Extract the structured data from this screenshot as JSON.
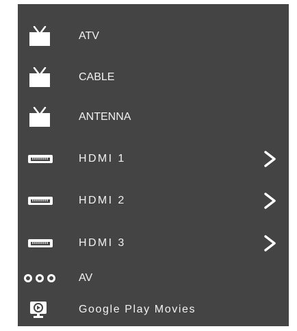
{
  "inputs": {
    "items": [
      {
        "label": "ATV",
        "icon": "tv-icon",
        "has_submenu": false
      },
      {
        "label": "CABLE",
        "icon": "tv-icon",
        "has_submenu": false
      },
      {
        "label": "ANTENNA",
        "icon": "tv-icon",
        "has_submenu": false
      },
      {
        "label": "HDMI 1",
        "icon": "hdmi-port-icon",
        "has_submenu": true,
        "submenu_icon": "chevron-right-icon"
      },
      {
        "label": "HDMI 2",
        "icon": "hdmi-port-icon",
        "has_submenu": true,
        "submenu_icon": "chevron-right-icon"
      },
      {
        "label": "HDMI 3",
        "icon": "hdmi-port-icon",
        "has_submenu": true,
        "submenu_icon": "chevron-right-icon"
      },
      {
        "label": "AV",
        "icon": "av-connector-icon",
        "has_submenu": false
      },
      {
        "label": "Google Play Movies",
        "icon": "google-play-movies-icon",
        "has_submenu": false
      }
    ]
  },
  "colors": {
    "panel_background": "#444444",
    "text": "#f2f2f2",
    "icon": "#ffffff"
  }
}
